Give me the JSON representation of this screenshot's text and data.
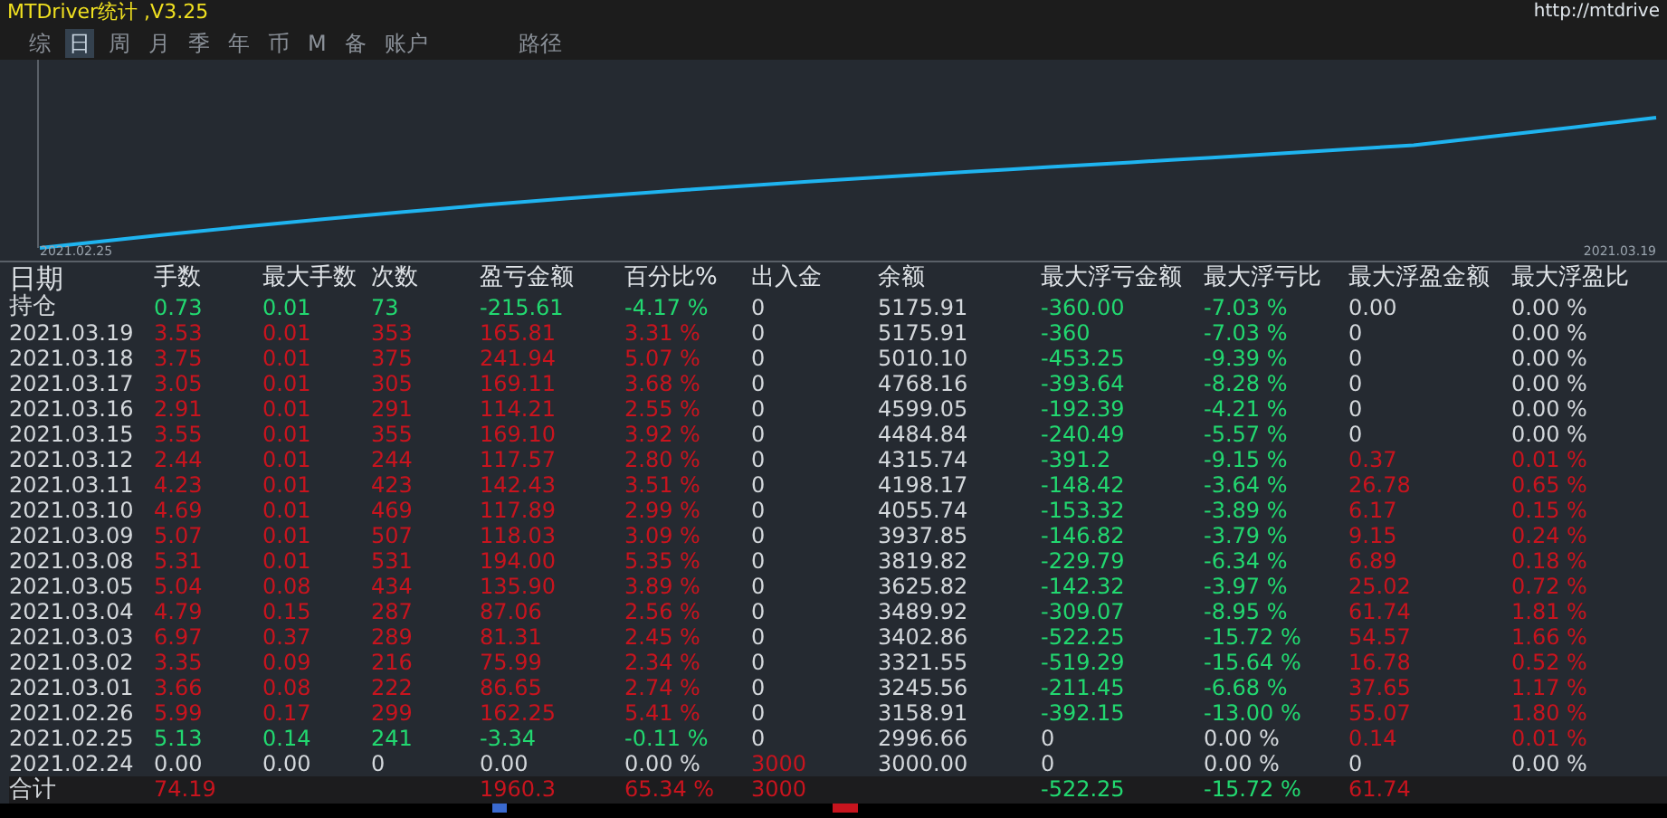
{
  "window": {
    "title": "MTDriver统计 ,V3.25",
    "url": "http://mtdrive"
  },
  "tabs": [
    {
      "label": "综",
      "selected": false
    },
    {
      "label": "日",
      "selected": true
    },
    {
      "label": "周",
      "selected": false
    },
    {
      "label": "月",
      "selected": false
    },
    {
      "label": "季",
      "selected": false
    },
    {
      "label": "年",
      "selected": false
    },
    {
      "label": "币",
      "selected": false
    },
    {
      "label": "M",
      "selected": false
    },
    {
      "label": "备",
      "selected": false
    },
    {
      "label": "账户",
      "selected": false
    },
    {
      "label": "路径",
      "selected": false
    }
  ],
  "chart": {
    "start_label": "2021.02.25",
    "end_label": "2021.03.19"
  },
  "table": {
    "columns": [
      "日期",
      "手数",
      "最大手数",
      "次数",
      "盈亏金额",
      "百分比%",
      "出入金",
      "余额",
      "最大浮亏金额",
      "最大浮亏比",
      "最大浮盈金额",
      "最大浮盈比"
    ],
    "rows": [
      [
        {
          "text": "持仓",
          "color": "#d4d8dc"
        },
        {
          "text": "0.73",
          "color": "#22d870"
        },
        {
          "text": "0.01",
          "color": "#22d870"
        },
        {
          "text": "73",
          "color": "#22d870"
        },
        {
          "text": "-215.61",
          "color": "#22d870"
        },
        {
          "text": "-4.17 %",
          "color": "#22d870"
        },
        {
          "text": "0",
          "color": "#d4d8dc"
        },
        {
          "text": "5175.91",
          "color": "#d4d8dc"
        },
        {
          "text": "-360.00",
          "color": "#22d870"
        },
        {
          "text": "-7.03 %",
          "color": "#22d870"
        },
        {
          "text": "0.00",
          "color": "#d4d8dc"
        },
        {
          "text": "0.00 %",
          "color": "#d4d8dc"
        }
      ],
      [
        {
          "text": "2021.03.19",
          "color": "#d4d8dc"
        },
        {
          "text": "3.53",
          "color": "#c8141e"
        },
        {
          "text": "0.01",
          "color": "#c8141e"
        },
        {
          "text": "353",
          "color": "#c8141e"
        },
        {
          "text": "165.81",
          "color": "#c8141e"
        },
        {
          "text": "3.31 %",
          "color": "#c8141e"
        },
        {
          "text": "0",
          "color": "#d4d8dc"
        },
        {
          "text": "5175.91",
          "color": "#d4d8dc"
        },
        {
          "text": "-360",
          "color": "#22d870"
        },
        {
          "text": "-7.03 %",
          "color": "#22d870"
        },
        {
          "text": "0",
          "color": "#d4d8dc"
        },
        {
          "text": "0.00 %",
          "color": "#d4d8dc"
        }
      ],
      [
        {
          "text": "2021.03.18",
          "color": "#d4d8dc"
        },
        {
          "text": "3.75",
          "color": "#c8141e"
        },
        {
          "text": "0.01",
          "color": "#c8141e"
        },
        {
          "text": "375",
          "color": "#c8141e"
        },
        {
          "text": "241.94",
          "color": "#c8141e"
        },
        {
          "text": "5.07 %",
          "color": "#c8141e"
        },
        {
          "text": "0",
          "color": "#d4d8dc"
        },
        {
          "text": "5010.10",
          "color": "#d4d8dc"
        },
        {
          "text": "-453.25",
          "color": "#22d870"
        },
        {
          "text": "-9.39 %",
          "color": "#22d870"
        },
        {
          "text": "0",
          "color": "#d4d8dc"
        },
        {
          "text": "0.00 %",
          "color": "#d4d8dc"
        }
      ],
      [
        {
          "text": "2021.03.17",
          "color": "#d4d8dc"
        },
        {
          "text": "3.05",
          "color": "#c8141e"
        },
        {
          "text": "0.01",
          "color": "#c8141e"
        },
        {
          "text": "305",
          "color": "#c8141e"
        },
        {
          "text": "169.11",
          "color": "#c8141e"
        },
        {
          "text": "3.68 %",
          "color": "#c8141e"
        },
        {
          "text": "0",
          "color": "#d4d8dc"
        },
        {
          "text": "4768.16",
          "color": "#d4d8dc"
        },
        {
          "text": "-393.64",
          "color": "#22d870"
        },
        {
          "text": "-8.28 %",
          "color": "#22d870"
        },
        {
          "text": "0",
          "color": "#d4d8dc"
        },
        {
          "text": "0.00 %",
          "color": "#d4d8dc"
        }
      ],
      [
        {
          "text": "2021.03.16",
          "color": "#d4d8dc"
        },
        {
          "text": "2.91",
          "color": "#c8141e"
        },
        {
          "text": "0.01",
          "color": "#c8141e"
        },
        {
          "text": "291",
          "color": "#c8141e"
        },
        {
          "text": "114.21",
          "color": "#c8141e"
        },
        {
          "text": "2.55 %",
          "color": "#c8141e"
        },
        {
          "text": "0",
          "color": "#d4d8dc"
        },
        {
          "text": "4599.05",
          "color": "#d4d8dc"
        },
        {
          "text": "-192.39",
          "color": "#22d870"
        },
        {
          "text": "-4.21 %",
          "color": "#22d870"
        },
        {
          "text": "0",
          "color": "#d4d8dc"
        },
        {
          "text": "0.00 %",
          "color": "#d4d8dc"
        }
      ],
      [
        {
          "text": "2021.03.15",
          "color": "#d4d8dc"
        },
        {
          "text": "3.55",
          "color": "#c8141e"
        },
        {
          "text": "0.01",
          "color": "#c8141e"
        },
        {
          "text": "355",
          "color": "#c8141e"
        },
        {
          "text": "169.10",
          "color": "#c8141e"
        },
        {
          "text": "3.92 %",
          "color": "#c8141e"
        },
        {
          "text": "0",
          "color": "#d4d8dc"
        },
        {
          "text": "4484.84",
          "color": "#d4d8dc"
        },
        {
          "text": "-240.49",
          "color": "#22d870"
        },
        {
          "text": "-5.57 %",
          "color": "#22d870"
        },
        {
          "text": "0",
          "color": "#d4d8dc"
        },
        {
          "text": "0.00 %",
          "color": "#d4d8dc"
        }
      ],
      [
        {
          "text": "2021.03.12",
          "color": "#d4d8dc"
        },
        {
          "text": "2.44",
          "color": "#c8141e"
        },
        {
          "text": "0.01",
          "color": "#c8141e"
        },
        {
          "text": "244",
          "color": "#c8141e"
        },
        {
          "text": "117.57",
          "color": "#c8141e"
        },
        {
          "text": "2.80 %",
          "color": "#c8141e"
        },
        {
          "text": "0",
          "color": "#d4d8dc"
        },
        {
          "text": "4315.74",
          "color": "#d4d8dc"
        },
        {
          "text": "-391.2",
          "color": "#22d870"
        },
        {
          "text": "-9.15 %",
          "color": "#22d870"
        },
        {
          "text": "0.37",
          "color": "#c8141e"
        },
        {
          "text": "0.01 %",
          "color": "#c8141e"
        }
      ],
      [
        {
          "text": "2021.03.11",
          "color": "#d4d8dc"
        },
        {
          "text": "4.23",
          "color": "#c8141e"
        },
        {
          "text": "0.01",
          "color": "#c8141e"
        },
        {
          "text": "423",
          "color": "#c8141e"
        },
        {
          "text": "142.43",
          "color": "#c8141e"
        },
        {
          "text": "3.51 %",
          "color": "#c8141e"
        },
        {
          "text": "0",
          "color": "#d4d8dc"
        },
        {
          "text": "4198.17",
          "color": "#d4d8dc"
        },
        {
          "text": "-148.42",
          "color": "#22d870"
        },
        {
          "text": "-3.64 %",
          "color": "#22d870"
        },
        {
          "text": "26.78",
          "color": "#c8141e"
        },
        {
          "text": "0.65 %",
          "color": "#c8141e"
        }
      ],
      [
        {
          "text": "2021.03.10",
          "color": "#d4d8dc"
        },
        {
          "text": "4.69",
          "color": "#c8141e"
        },
        {
          "text": "0.01",
          "color": "#c8141e"
        },
        {
          "text": "469",
          "color": "#c8141e"
        },
        {
          "text": "117.89",
          "color": "#c8141e"
        },
        {
          "text": "2.99 %",
          "color": "#c8141e"
        },
        {
          "text": "0",
          "color": "#d4d8dc"
        },
        {
          "text": "4055.74",
          "color": "#d4d8dc"
        },
        {
          "text": "-153.32",
          "color": "#22d870"
        },
        {
          "text": "-3.89 %",
          "color": "#22d870"
        },
        {
          "text": "6.17",
          "color": "#c8141e"
        },
        {
          "text": "0.15 %",
          "color": "#c8141e"
        }
      ],
      [
        {
          "text": "2021.03.09",
          "color": "#d4d8dc"
        },
        {
          "text": "5.07",
          "color": "#c8141e"
        },
        {
          "text": "0.01",
          "color": "#c8141e"
        },
        {
          "text": "507",
          "color": "#c8141e"
        },
        {
          "text": "118.03",
          "color": "#c8141e"
        },
        {
          "text": "3.09 %",
          "color": "#c8141e"
        },
        {
          "text": "0",
          "color": "#d4d8dc"
        },
        {
          "text": "3937.85",
          "color": "#d4d8dc"
        },
        {
          "text": "-146.82",
          "color": "#22d870"
        },
        {
          "text": "-3.79 %",
          "color": "#22d870"
        },
        {
          "text": "9.15",
          "color": "#c8141e"
        },
        {
          "text": "0.24 %",
          "color": "#c8141e"
        }
      ],
      [
        {
          "text": "2021.03.08",
          "color": "#d4d8dc"
        },
        {
          "text": "5.31",
          "color": "#c8141e"
        },
        {
          "text": "0.01",
          "color": "#c8141e"
        },
        {
          "text": "531",
          "color": "#c8141e"
        },
        {
          "text": "194.00",
          "color": "#c8141e"
        },
        {
          "text": "5.35 %",
          "color": "#c8141e"
        },
        {
          "text": "0",
          "color": "#d4d8dc"
        },
        {
          "text": "3819.82",
          "color": "#d4d8dc"
        },
        {
          "text": "-229.79",
          "color": "#22d870"
        },
        {
          "text": "-6.34 %",
          "color": "#22d870"
        },
        {
          "text": "6.89",
          "color": "#c8141e"
        },
        {
          "text": "0.18 %",
          "color": "#c8141e"
        }
      ],
      [
        {
          "text": "2021.03.05",
          "color": "#d4d8dc"
        },
        {
          "text": "5.04",
          "color": "#c8141e"
        },
        {
          "text": "0.08",
          "color": "#c8141e"
        },
        {
          "text": "434",
          "color": "#c8141e"
        },
        {
          "text": "135.90",
          "color": "#c8141e"
        },
        {
          "text": "3.89 %",
          "color": "#c8141e"
        },
        {
          "text": "0",
          "color": "#d4d8dc"
        },
        {
          "text": "3625.82",
          "color": "#d4d8dc"
        },
        {
          "text": "-142.32",
          "color": "#22d870"
        },
        {
          "text": "-3.97 %",
          "color": "#22d870"
        },
        {
          "text": "25.02",
          "color": "#c8141e"
        },
        {
          "text": "0.72 %",
          "color": "#c8141e"
        }
      ],
      [
        {
          "text": "2021.03.04",
          "color": "#d4d8dc"
        },
        {
          "text": "4.79",
          "color": "#c8141e"
        },
        {
          "text": "0.15",
          "color": "#c8141e"
        },
        {
          "text": "287",
          "color": "#c8141e"
        },
        {
          "text": "87.06",
          "color": "#c8141e"
        },
        {
          "text": "2.56 %",
          "color": "#c8141e"
        },
        {
          "text": "0",
          "color": "#d4d8dc"
        },
        {
          "text": "3489.92",
          "color": "#d4d8dc"
        },
        {
          "text": "-309.07",
          "color": "#22d870"
        },
        {
          "text": "-8.95 %",
          "color": "#22d870"
        },
        {
          "text": "61.74",
          "color": "#c8141e"
        },
        {
          "text": "1.81 %",
          "color": "#c8141e"
        }
      ],
      [
        {
          "text": "2021.03.03",
          "color": "#d4d8dc"
        },
        {
          "text": "6.97",
          "color": "#c8141e"
        },
        {
          "text": "0.37",
          "color": "#c8141e"
        },
        {
          "text": "289",
          "color": "#c8141e"
        },
        {
          "text": "81.31",
          "color": "#c8141e"
        },
        {
          "text": "2.45 %",
          "color": "#c8141e"
        },
        {
          "text": "0",
          "color": "#d4d8dc"
        },
        {
          "text": "3402.86",
          "color": "#d4d8dc"
        },
        {
          "text": "-522.25",
          "color": "#22d870"
        },
        {
          "text": "-15.72 %",
          "color": "#22d870"
        },
        {
          "text": "54.57",
          "color": "#c8141e"
        },
        {
          "text": "1.66 %",
          "color": "#c8141e"
        }
      ],
      [
        {
          "text": "2021.03.02",
          "color": "#d4d8dc"
        },
        {
          "text": "3.35",
          "color": "#c8141e"
        },
        {
          "text": "0.09",
          "color": "#c8141e"
        },
        {
          "text": "216",
          "color": "#c8141e"
        },
        {
          "text": "75.99",
          "color": "#c8141e"
        },
        {
          "text": "2.34 %",
          "color": "#c8141e"
        },
        {
          "text": "0",
          "color": "#d4d8dc"
        },
        {
          "text": "3321.55",
          "color": "#d4d8dc"
        },
        {
          "text": "-519.29",
          "color": "#22d870"
        },
        {
          "text": "-15.64 %",
          "color": "#22d870"
        },
        {
          "text": "16.78",
          "color": "#c8141e"
        },
        {
          "text": "0.52 %",
          "color": "#c8141e"
        }
      ],
      [
        {
          "text": "2021.03.01",
          "color": "#d4d8dc"
        },
        {
          "text": "3.66",
          "color": "#c8141e"
        },
        {
          "text": "0.08",
          "color": "#c8141e"
        },
        {
          "text": "222",
          "color": "#c8141e"
        },
        {
          "text": "86.65",
          "color": "#c8141e"
        },
        {
          "text": "2.74 %",
          "color": "#c8141e"
        },
        {
          "text": "0",
          "color": "#d4d8dc"
        },
        {
          "text": "3245.56",
          "color": "#d4d8dc"
        },
        {
          "text": "-211.45",
          "color": "#22d870"
        },
        {
          "text": "-6.68 %",
          "color": "#22d870"
        },
        {
          "text": "37.65",
          "color": "#c8141e"
        },
        {
          "text": "1.17 %",
          "color": "#c8141e"
        }
      ],
      [
        {
          "text": "2021.02.26",
          "color": "#d4d8dc"
        },
        {
          "text": "5.99",
          "color": "#c8141e"
        },
        {
          "text": "0.17",
          "color": "#c8141e"
        },
        {
          "text": "299",
          "color": "#c8141e"
        },
        {
          "text": "162.25",
          "color": "#c8141e"
        },
        {
          "text": "5.41 %",
          "color": "#c8141e"
        },
        {
          "text": "0",
          "color": "#d4d8dc"
        },
        {
          "text": "3158.91",
          "color": "#d4d8dc"
        },
        {
          "text": "-392.15",
          "color": "#22d870"
        },
        {
          "text": "-13.00 %",
          "color": "#22d870"
        },
        {
          "text": "55.07",
          "color": "#c8141e"
        },
        {
          "text": "1.80 %",
          "color": "#c8141e"
        }
      ],
      [
        {
          "text": "2021.02.25",
          "color": "#d4d8dc"
        },
        {
          "text": "5.13",
          "color": "#22d870"
        },
        {
          "text": "0.14",
          "color": "#22d870"
        },
        {
          "text": "241",
          "color": "#22d870"
        },
        {
          "text": "-3.34",
          "color": "#22d870"
        },
        {
          "text": "-0.11 %",
          "color": "#22d870"
        },
        {
          "text": "0",
          "color": "#d4d8dc"
        },
        {
          "text": "2996.66",
          "color": "#d4d8dc"
        },
        {
          "text": "0",
          "color": "#d4d8dc"
        },
        {
          "text": "0.00 %",
          "color": "#d4d8dc"
        },
        {
          "text": "0.14",
          "color": "#c8141e"
        },
        {
          "text": "0.01 %",
          "color": "#c8141e"
        }
      ],
      [
        {
          "text": "2021.02.24",
          "color": "#d4d8dc"
        },
        {
          "text": "0.00",
          "color": "#d4d8dc"
        },
        {
          "text": "0.00",
          "color": "#d4d8dc"
        },
        {
          "text": "0",
          "color": "#d4d8dc"
        },
        {
          "text": "0.00",
          "color": "#d4d8dc"
        },
        {
          "text": "0.00 %",
          "color": "#d4d8dc"
        },
        {
          "text": "3000",
          "color": "#c8141e"
        },
        {
          "text": "3000.00",
          "color": "#d4d8dc"
        },
        {
          "text": "0",
          "color": "#d4d8dc"
        },
        {
          "text": "0.00 %",
          "color": "#d4d8dc"
        },
        {
          "text": "0",
          "color": "#d4d8dc"
        },
        {
          "text": "0.00 %",
          "color": "#d4d8dc"
        }
      ],
      [
        {
          "text": "合计",
          "color": "#d4d8dc"
        },
        {
          "text": "74.19",
          "color": "#c8141e"
        },
        {
          "text": ""
        },
        {
          "text": ""
        },
        {
          "text": "1960.3",
          "color": "#c8141e"
        },
        {
          "text": "65.34 %",
          "color": "#c8141e"
        },
        {
          "text": "3000",
          "color": "#c8141e"
        },
        {
          "text": ""
        },
        {
          "text": "-522.25",
          "color": "#22d870"
        },
        {
          "text": "-15.72 %",
          "color": "#22d870"
        },
        {
          "text": "61.74",
          "color": "#c8141e"
        },
        {
          "text": ""
        }
      ]
    ]
  }
}
